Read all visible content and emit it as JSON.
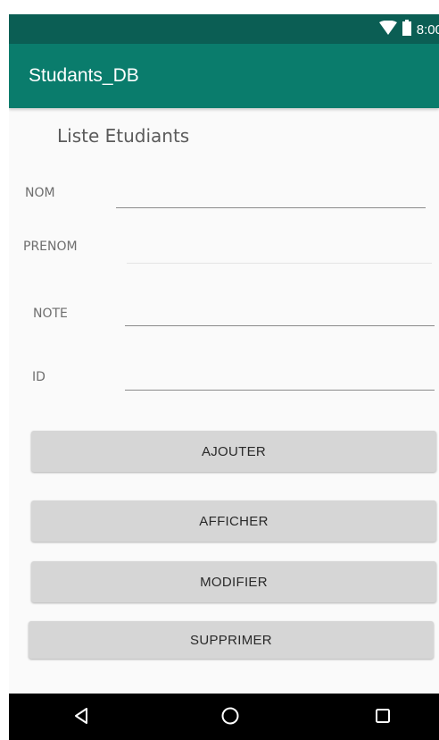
{
  "status_bar": {
    "time": "8:00",
    "icons": [
      "wifi-icon",
      "battery-icon"
    ],
    "color": "#0b5e54"
  },
  "app_bar": {
    "title": "Studants_DB",
    "color": "#0a7c6c"
  },
  "form": {
    "heading": "Liste Etudiants",
    "fields": {
      "nom": {
        "label": "NOM",
        "value": ""
      },
      "prenom": {
        "label": "PRENOM",
        "value": ""
      },
      "note": {
        "label": "NOTE",
        "value": ""
      },
      "id": {
        "label": "ID",
        "value": ""
      }
    }
  },
  "buttons": {
    "ajouter": "AJOUTER",
    "afficher": "AFFICHER",
    "modifier": "MODIFIER",
    "supprimer": "SUPPRIMER"
  },
  "nav_bar": {
    "icons": [
      "back-triangle-icon",
      "home-circle-icon",
      "recents-square-icon"
    ]
  }
}
